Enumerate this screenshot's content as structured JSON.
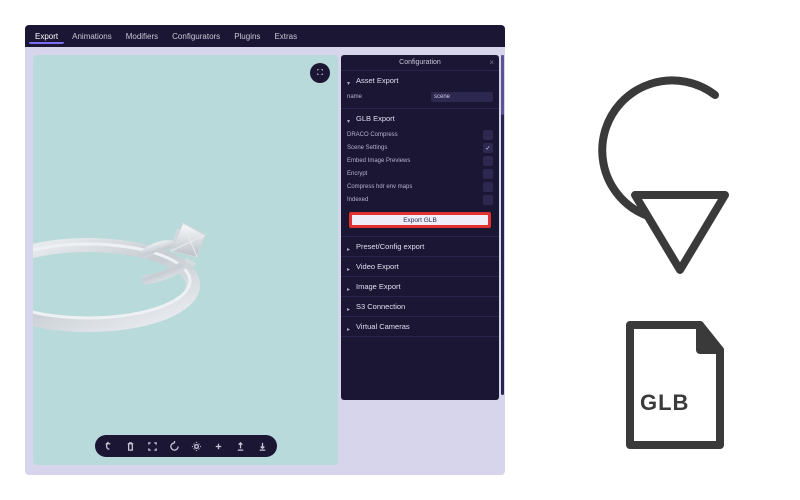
{
  "topbar": {
    "tabs": [
      "Export",
      "Animations",
      "Modifiers",
      "Configurators",
      "Plugins",
      "Extras"
    ],
    "active": 0
  },
  "sidepanel": {
    "title": "Configuration",
    "sections": {
      "assetExport": {
        "label": "Asset Export",
        "nameLabel": "name",
        "nameValue": "scene"
      },
      "glbExport": {
        "label": "GLB Export",
        "options": [
          {
            "label": "DRACO Compress",
            "checked": false
          },
          {
            "label": "Scene Settings",
            "checked": true
          },
          {
            "label": "Embed Image Previews",
            "checked": false
          },
          {
            "label": "Encrypt",
            "checked": false
          },
          {
            "label": "Compress hdr env maps",
            "checked": false
          },
          {
            "label": "Indexed",
            "checked": false
          }
        ],
        "exportButton": "Export GLB"
      },
      "presetConfig": {
        "label": "Preset/Config export"
      },
      "videoExport": {
        "label": "Video Export"
      },
      "imageExport": {
        "label": "Image Export"
      },
      "s3": {
        "label": "S3 Connection"
      },
      "virtualCameras": {
        "label": "Virtual Cameras"
      }
    }
  },
  "fileBadge": "GLB"
}
